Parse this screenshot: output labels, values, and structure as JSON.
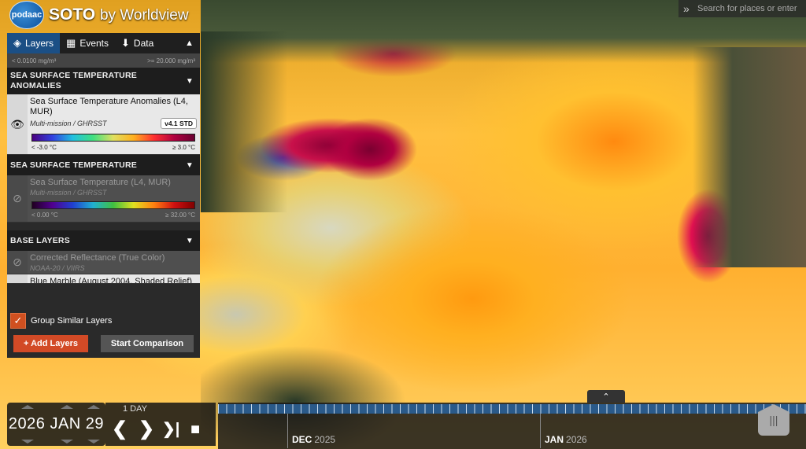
{
  "app": {
    "title": "SOTO",
    "title_suffix": "by Worldview",
    "logo_text": "podaac"
  },
  "search": {
    "placeholder": "Search for places or enter"
  },
  "tabs": [
    {
      "label": "Layers",
      "icon": "layers-icon"
    },
    {
      "label": "Events",
      "icon": "calendar-icon"
    },
    {
      "label": "Data",
      "icon": "download-icon"
    }
  ],
  "prev_legend": {
    "min": "< 0.0100 mg/m³",
    "max": ">= 20.000 mg/m³"
  },
  "groups": {
    "anomalies": {
      "title": "Sea Surface Temperature Anomalies",
      "layer": {
        "name": "Sea Surface Temperature Anomalies (L4, MUR)",
        "source": "Multi-mission / GHRSST",
        "badge": "v4.1 STD",
        "min": "< -3.0 °C",
        "max": "≥ 3.0 °C",
        "visible": true
      }
    },
    "sst": {
      "title": "Sea Surface Temperature",
      "layer": {
        "name": "Sea Surface Temperature (L4, MUR)",
        "source": "Multi-mission / GHRSST",
        "min": "< 0.00 °C",
        "max": "≥ 32.00 °C",
        "visible": false
      }
    },
    "base": {
      "title": "Base Layers",
      "layers": [
        {
          "name": "Corrected Reflectance (True Color)",
          "source": "NOAA-20 / VIIRS",
          "visible": false
        },
        {
          "name": "Blue Marble (August 2004, Shaded Relief)"
        }
      ]
    }
  },
  "footer": {
    "group_label": "Group Similar Layers",
    "group_checked": true,
    "add_label": "+ Add Layers",
    "compare_label": "Start Comparison"
  },
  "date": {
    "display": "2026 JAN 29",
    "interval": "1 DAY"
  },
  "timeline": {
    "months": [
      {
        "label": "DEC",
        "year": "2025"
      },
      {
        "label": "JAN",
        "year": "2026"
      }
    ]
  },
  "colors": {
    "accent": "#d24a26",
    "tab_active": "#1b4f85"
  }
}
